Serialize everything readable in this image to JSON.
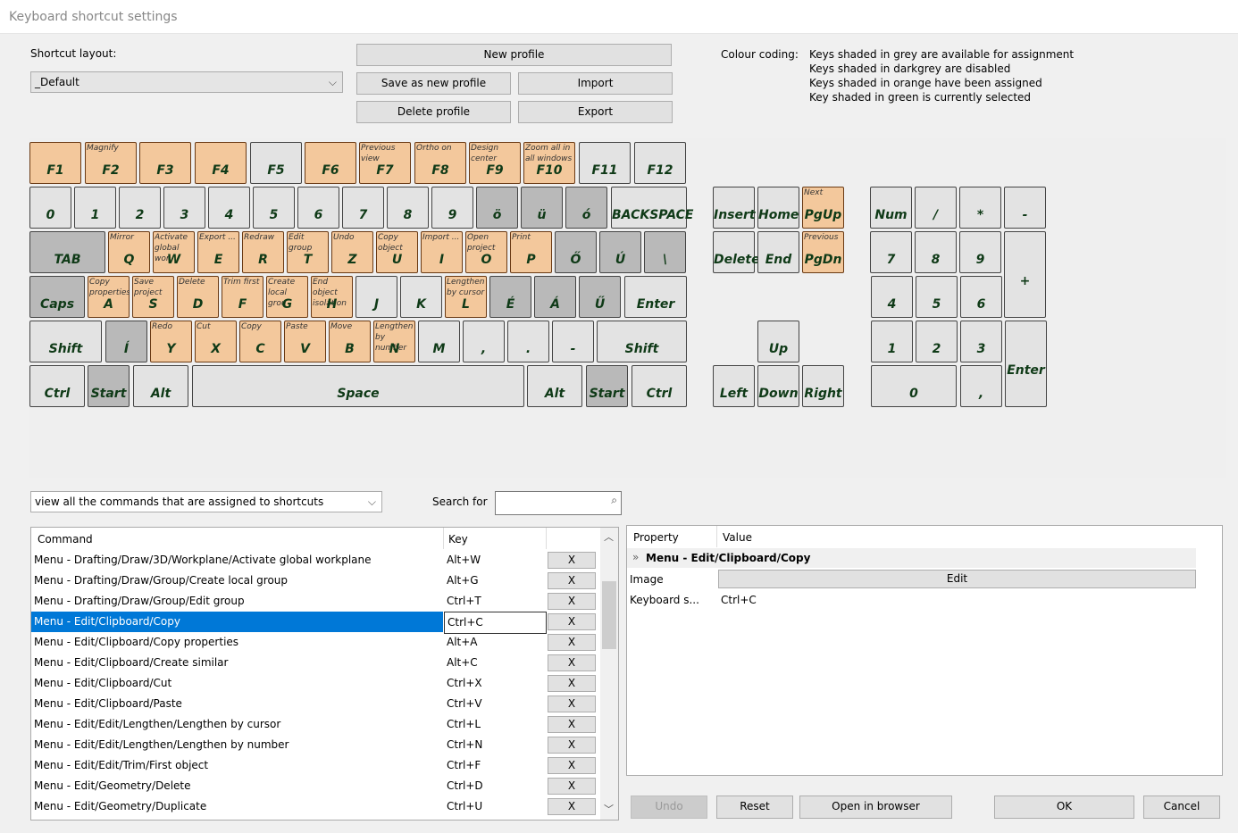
{
  "window": {
    "title": "Keyboard shortcut settings"
  },
  "layout": {
    "label": "Shortcut layout:",
    "selected": "_Default"
  },
  "buttons": {
    "new_profile": "New profile",
    "save_as_new": "Save as new profile",
    "import": "Import",
    "delete_profile": "Delete profile",
    "export": "Export",
    "undo": "Undo",
    "reset": "Reset",
    "open_browser": "Open in browser",
    "ok": "OK",
    "cancel": "Cancel"
  },
  "colour_coding": {
    "label": "Colour coding:",
    "lines": [
      "Keys shaded in grey are available for assignment",
      "Keys shaded in darkgrey are disabled",
      "Keys shaded in orange have been assigned",
      "Key shaded in green is currently selected"
    ]
  },
  "colors": {
    "available": "#e3e3e3",
    "disabled": "#b9b9b9",
    "assigned": "#f3c89c",
    "selected_row": "#0078d7"
  },
  "keyboard": {
    "keys": [
      {
        "l": "F1",
        "s": "a"
      },
      {
        "l": "F2",
        "h": "Magnify",
        "s": "a"
      },
      {
        "l": "F3",
        "s": "a"
      },
      {
        "l": "F4",
        "s": "a"
      },
      {
        "l": "F5",
        "s": "g"
      },
      {
        "l": "F6",
        "s": "a"
      },
      {
        "l": "F7",
        "h": "Previous view",
        "s": "a"
      },
      {
        "l": "F8",
        "h": "Ortho on",
        "s": "a"
      },
      {
        "l": "F9",
        "h": "Design center",
        "s": "a"
      },
      {
        "l": "F10",
        "h": "Zoom all in all windows",
        "s": "a"
      },
      {
        "l": "F11",
        "s": "g"
      },
      {
        "l": "F12",
        "s": "g"
      },
      {
        "l": "0",
        "s": "g"
      },
      {
        "l": "1",
        "s": "g"
      },
      {
        "l": "2",
        "s": "g"
      },
      {
        "l": "3",
        "s": "g"
      },
      {
        "l": "4",
        "s": "g"
      },
      {
        "l": "5",
        "s": "g"
      },
      {
        "l": "6",
        "s": "g"
      },
      {
        "l": "7",
        "s": "g"
      },
      {
        "l": "8",
        "s": "g"
      },
      {
        "l": "9",
        "s": "g"
      },
      {
        "l": "ö",
        "s": "d"
      },
      {
        "l": "ü",
        "s": "d"
      },
      {
        "l": "ó",
        "s": "d"
      },
      {
        "l": "BACKSPACE",
        "s": "g"
      },
      {
        "l": "TAB",
        "s": "d"
      },
      {
        "l": "Q",
        "h": "Mirror",
        "s": "a"
      },
      {
        "l": "W",
        "h": "Activate global wor",
        "s": "a"
      },
      {
        "l": "E",
        "h": "Export ...",
        "s": "a"
      },
      {
        "l": "R",
        "h": "Redraw",
        "s": "a"
      },
      {
        "l": "T",
        "h": "Edit group",
        "s": "a"
      },
      {
        "l": "Z",
        "h": "Undo",
        "s": "a"
      },
      {
        "l": "U",
        "h": "Copy object",
        "s": "a"
      },
      {
        "l": "I",
        "h": "Import ...",
        "s": "a"
      },
      {
        "l": "O",
        "h": "Open project",
        "s": "a"
      },
      {
        "l": "P",
        "h": "Print",
        "s": "a"
      },
      {
        "l": "Ő",
        "s": "d"
      },
      {
        "l": "Ú",
        "s": "d"
      },
      {
        "l": "\\",
        "s": "d"
      },
      {
        "l": "Caps",
        "s": "d"
      },
      {
        "l": "A",
        "h": "Copy properties",
        "s": "a"
      },
      {
        "l": "S",
        "h": "Save project",
        "s": "a"
      },
      {
        "l": "D",
        "h": "Delete",
        "s": "a"
      },
      {
        "l": "F",
        "h": "Trim first",
        "s": "a"
      },
      {
        "l": "G",
        "h": "Create local grou",
        "s": "a"
      },
      {
        "l": "H",
        "h": "End object isolation",
        "s": "a"
      },
      {
        "l": "J",
        "s": "g"
      },
      {
        "l": "K",
        "s": "g"
      },
      {
        "l": "L",
        "h": "Lengthen by cursor",
        "s": "a"
      },
      {
        "l": "É",
        "s": "d"
      },
      {
        "l": "Á",
        "s": "d"
      },
      {
        "l": "Ű",
        "s": "d"
      },
      {
        "l": "Enter",
        "s": "g"
      },
      {
        "l": "Shift",
        "s": "g"
      },
      {
        "l": "Í",
        "s": "d"
      },
      {
        "l": "Y",
        "h": "Redo",
        "s": "a"
      },
      {
        "l": "X",
        "h": "Cut",
        "s": "a"
      },
      {
        "l": "C",
        "h": "Copy",
        "s": "a"
      },
      {
        "l": "V",
        "h": "Paste",
        "s": "a"
      },
      {
        "l": "B",
        "h": "Move",
        "s": "a"
      },
      {
        "l": "N",
        "h": "Lengthen by number",
        "s": "a"
      },
      {
        "l": "M",
        "s": "g"
      },
      {
        "l": ",",
        "s": "g"
      },
      {
        "l": ".",
        "s": "g"
      },
      {
        "l": "-",
        "s": "g"
      },
      {
        "l": "Shift",
        "s": "g"
      },
      {
        "l": "Ctrl",
        "s": "g"
      },
      {
        "l": "Start",
        "s": "d"
      },
      {
        "l": "Alt",
        "s": "g"
      },
      {
        "l": "Space",
        "s": "g"
      },
      {
        "l": "Alt",
        "s": "g"
      },
      {
        "l": "Start",
        "s": "d"
      },
      {
        "l": "Ctrl",
        "s": "g"
      },
      {
        "l": "Insert",
        "s": "g"
      },
      {
        "l": "Home",
        "s": "g"
      },
      {
        "l": "PgUp",
        "h": "Next",
        "s": "a"
      },
      {
        "l": "Delete",
        "s": "g"
      },
      {
        "l": "End",
        "s": "g"
      },
      {
        "l": "PgDn",
        "h": "Previous",
        "s": "a"
      },
      {
        "l": "Up",
        "s": "g"
      },
      {
        "l": "Left",
        "s": "g"
      },
      {
        "l": "Down",
        "s": "g"
      },
      {
        "l": "Right",
        "s": "g"
      },
      {
        "l": "Num",
        "s": "g"
      },
      {
        "l": "/",
        "s": "g"
      },
      {
        "l": "*",
        "s": "g"
      },
      {
        "l": "-",
        "s": "g"
      },
      {
        "l": "7",
        "s": "g"
      },
      {
        "l": "8",
        "s": "g"
      },
      {
        "l": "9",
        "s": "g"
      },
      {
        "l": "+",
        "s": "g"
      },
      {
        "l": "4",
        "s": "g"
      },
      {
        "l": "5",
        "s": "g"
      },
      {
        "l": "6",
        "s": "g"
      },
      {
        "l": "1",
        "s": "g"
      },
      {
        "l": "2",
        "s": "g"
      },
      {
        "l": "3",
        "s": "g"
      },
      {
        "l": "Enter",
        "s": "g"
      },
      {
        "l": "0",
        "s": "g"
      },
      {
        "l": ",",
        "s": "g"
      }
    ]
  },
  "filter": {
    "selected": "view all the commands that are assigned to shortcuts",
    "search_label": "Search for",
    "search_value": ""
  },
  "list": {
    "headers": {
      "command": "Command",
      "key": "Key"
    },
    "remove_label": "X",
    "rows": [
      {
        "c": "Menu - Drafting/Draw/3D/Workplane/Activate global workplane",
        "k": "Alt+W"
      },
      {
        "c": "Menu - Drafting/Draw/Group/Create local group",
        "k": "Alt+G"
      },
      {
        "c": "Menu - Drafting/Draw/Group/Edit group",
        "k": "Ctrl+T"
      },
      {
        "c": "Menu - Edit/Clipboard/Copy",
        "k": "Ctrl+C",
        "sel": true
      },
      {
        "c": "Menu - Edit/Clipboard/Copy properties",
        "k": "Alt+A"
      },
      {
        "c": "Menu - Edit/Clipboard/Create similar",
        "k": "Alt+C"
      },
      {
        "c": "Menu - Edit/Clipboard/Cut",
        "k": "Ctrl+X"
      },
      {
        "c": "Menu - Edit/Clipboard/Paste",
        "k": "Ctrl+V"
      },
      {
        "c": "Menu - Edit/Edit/Lengthen/Lengthen by cursor",
        "k": "Ctrl+L"
      },
      {
        "c": "Menu - Edit/Edit/Lengthen/Lengthen by number",
        "k": "Ctrl+N"
      },
      {
        "c": "Menu - Edit/Edit/Trim/First object",
        "k": "Ctrl+F"
      },
      {
        "c": "Menu - Edit/Geometry/Delete",
        "k": "Ctrl+D"
      },
      {
        "c": "Menu - Edit/Geometry/Duplicate",
        "k": "Ctrl+U"
      }
    ]
  },
  "properties": {
    "headers": {
      "property": "Property",
      "value": "Value"
    },
    "group": "Menu - Edit/Clipboard/Copy",
    "image_label": "Image",
    "image_button": "Edit",
    "shortcut_label": "Keyboard s...",
    "shortcut_value": "Ctrl+C"
  }
}
